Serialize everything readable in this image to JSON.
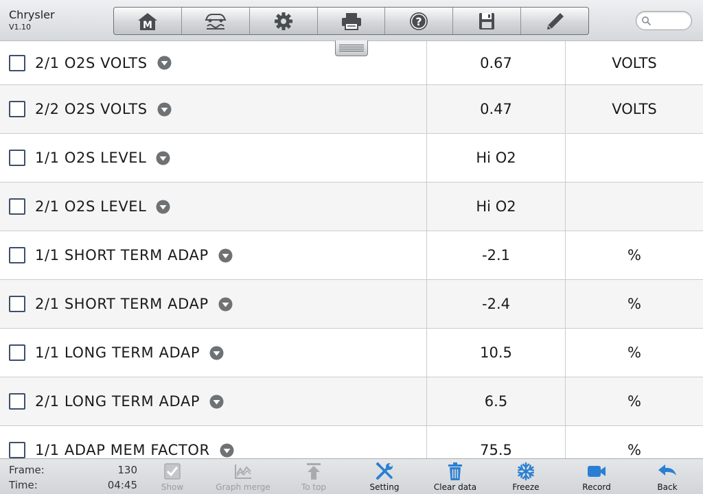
{
  "header": {
    "app_name": "Chrysler",
    "version": "V1.10",
    "toolbar": [
      {
        "icon": "home-m-icon"
      },
      {
        "icon": "vehicle-connect-icon"
      },
      {
        "icon": "gear-icon"
      },
      {
        "icon": "printer-icon"
      },
      {
        "icon": "help-icon"
      },
      {
        "icon": "save-icon"
      },
      {
        "icon": "pencil-icon"
      }
    ],
    "search": {
      "placeholder": "",
      "value": ""
    }
  },
  "table": {
    "rows": [
      {
        "name": "2/1 O2S VOLTS",
        "value": "0.67",
        "unit": "VOLTS"
      },
      {
        "name": "2/2 O2S VOLTS",
        "value": "0.47",
        "unit": "VOLTS"
      },
      {
        "name": "1/1 O2S LEVEL",
        "value": "Hi O2",
        "unit": ""
      },
      {
        "name": "2/1 O2S LEVEL",
        "value": "Hi O2",
        "unit": ""
      },
      {
        "name": "1/1 SHORT TERM ADAP",
        "value": "-2.1",
        "unit": "%"
      },
      {
        "name": "2/1 SHORT TERM ADAP",
        "value": "-2.4",
        "unit": "%"
      },
      {
        "name": "1/1 LONG TERM ADAP",
        "value": "10.5",
        "unit": "%"
      },
      {
        "name": "2/1 LONG TERM ADAP",
        "value": "6.5",
        "unit": "%"
      },
      {
        "name": "1/1 ADAP MEM FACTOR",
        "value": "75.5",
        "unit": "%"
      }
    ]
  },
  "footer": {
    "frame_label": "Frame:",
    "frame_value": "130",
    "time_label": "Time:",
    "time_value": "04:45",
    "buttons": [
      {
        "label": "Show",
        "icon": "checkbox-icon",
        "enabled": false
      },
      {
        "label": "Graph merge",
        "icon": "graph-icon",
        "enabled": false
      },
      {
        "label": "To top",
        "icon": "to-top-icon",
        "enabled": false
      },
      {
        "label": "Setting",
        "icon": "wrench-screwdriver-icon",
        "enabled": true
      },
      {
        "label": "Clear data",
        "icon": "trash-icon",
        "enabled": true
      },
      {
        "label": "Freeze",
        "icon": "snowflake-icon",
        "enabled": true
      },
      {
        "label": "Record",
        "icon": "video-camera-icon",
        "enabled": true
      },
      {
        "label": "Back",
        "icon": "back-arrow-icon",
        "enabled": true
      }
    ]
  },
  "colors": {
    "accent_blue": "#2a7fd4",
    "disabled_gray": "#a8abae",
    "checkbox_border": "#3d4f66",
    "dropdown_gray": "#6f7275"
  }
}
